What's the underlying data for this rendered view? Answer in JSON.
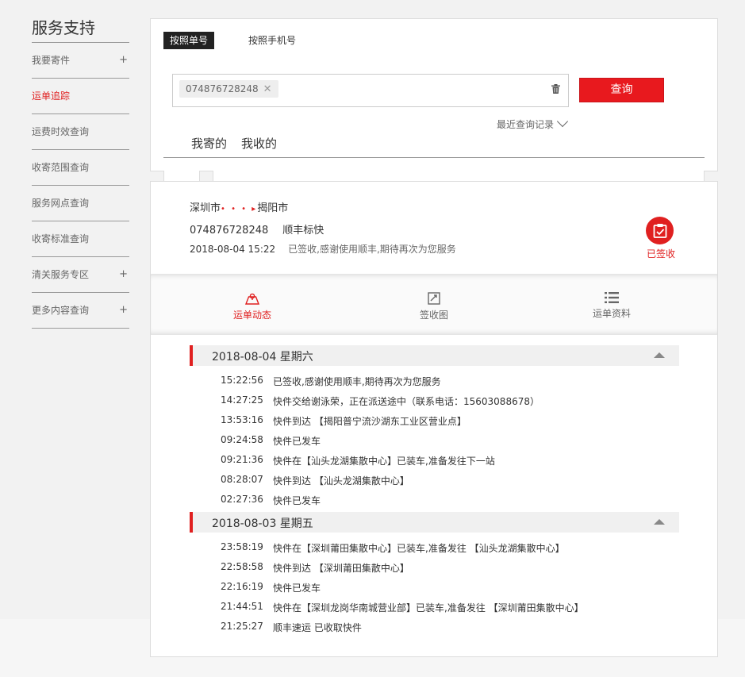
{
  "sidebar": {
    "title": "服务支持",
    "items": [
      {
        "label": "我要寄件",
        "plus": "+"
      },
      {
        "label": "运单追踪",
        "plus": ""
      },
      {
        "label": "运费时效查询",
        "plus": ""
      },
      {
        "label": "收寄范围查询",
        "plus": ""
      },
      {
        "label": "服务网点查询",
        "plus": ""
      },
      {
        "label": "收寄标准查询",
        "plus": ""
      },
      {
        "label": "清关服务专区",
        "plus": "+"
      },
      {
        "label": "更多内容查询",
        "plus": "+"
      }
    ]
  },
  "query": {
    "tab_by_waybill": "按照单号",
    "tab_by_phone": "按照手机号",
    "chip_value": "074876728248",
    "query_button": "查询",
    "recent_label": "最近查询记录",
    "subtab_sent": "我寄的",
    "subtab_received": "我收的"
  },
  "shipment": {
    "from": "深圳市",
    "to": "揭阳市",
    "route_dots": "• • • ▸",
    "waybill_no": "074876728248",
    "product": "顺丰标快",
    "sign_time": "2018-08-04 15:22",
    "sign_msg": "已签收,感谢使用顺丰,期待再次为您服务",
    "status": "已签收"
  },
  "detail_tabs": {
    "tracking": "运单动态",
    "signature": "签收图",
    "info": "运单资料"
  },
  "days": [
    {
      "date": "2018-08-04 星期六",
      "events": [
        {
          "time": "15:22:56",
          "text": "已签收,感谢使用顺丰,期待再次为您服务"
        },
        {
          "time": "14:27:25",
          "text": "快件交给谢泳荣，正在派送途中（联系电话：15603088678）"
        },
        {
          "time": "13:53:16",
          "text": "快件到达 【揭阳普宁流沙湖东工业区营业点】"
        },
        {
          "time": "09:24:58",
          "text": "快件已发车"
        },
        {
          "time": "09:21:36",
          "text": "快件在【汕头龙湖集散中心】已装车,准备发往下一站"
        },
        {
          "time": "08:28:07",
          "text": "快件到达 【汕头龙湖集散中心】"
        },
        {
          "time": "02:27:36",
          "text": "快件已发车"
        }
      ]
    },
    {
      "date": "2018-08-03 星期五",
      "events": [
        {
          "time": "23:58:19",
          "text": "快件在【深圳莆田集散中心】已装车,准备发往 【汕头龙湖集散中心】"
        },
        {
          "time": "22:58:58",
          "text": "快件到达 【深圳莆田集散中心】"
        },
        {
          "time": "22:16:19",
          "text": "快件已发车"
        },
        {
          "time": "21:44:51",
          "text": "快件在【深圳龙岗华南城营业部】已装车,准备发往 【深圳莆田集散中心】"
        },
        {
          "time": "21:25:27",
          "text": "顺丰速运 已收取快件"
        }
      ]
    }
  ],
  "colors": {
    "accent": "#e02020",
    "button": "#e8191e"
  }
}
